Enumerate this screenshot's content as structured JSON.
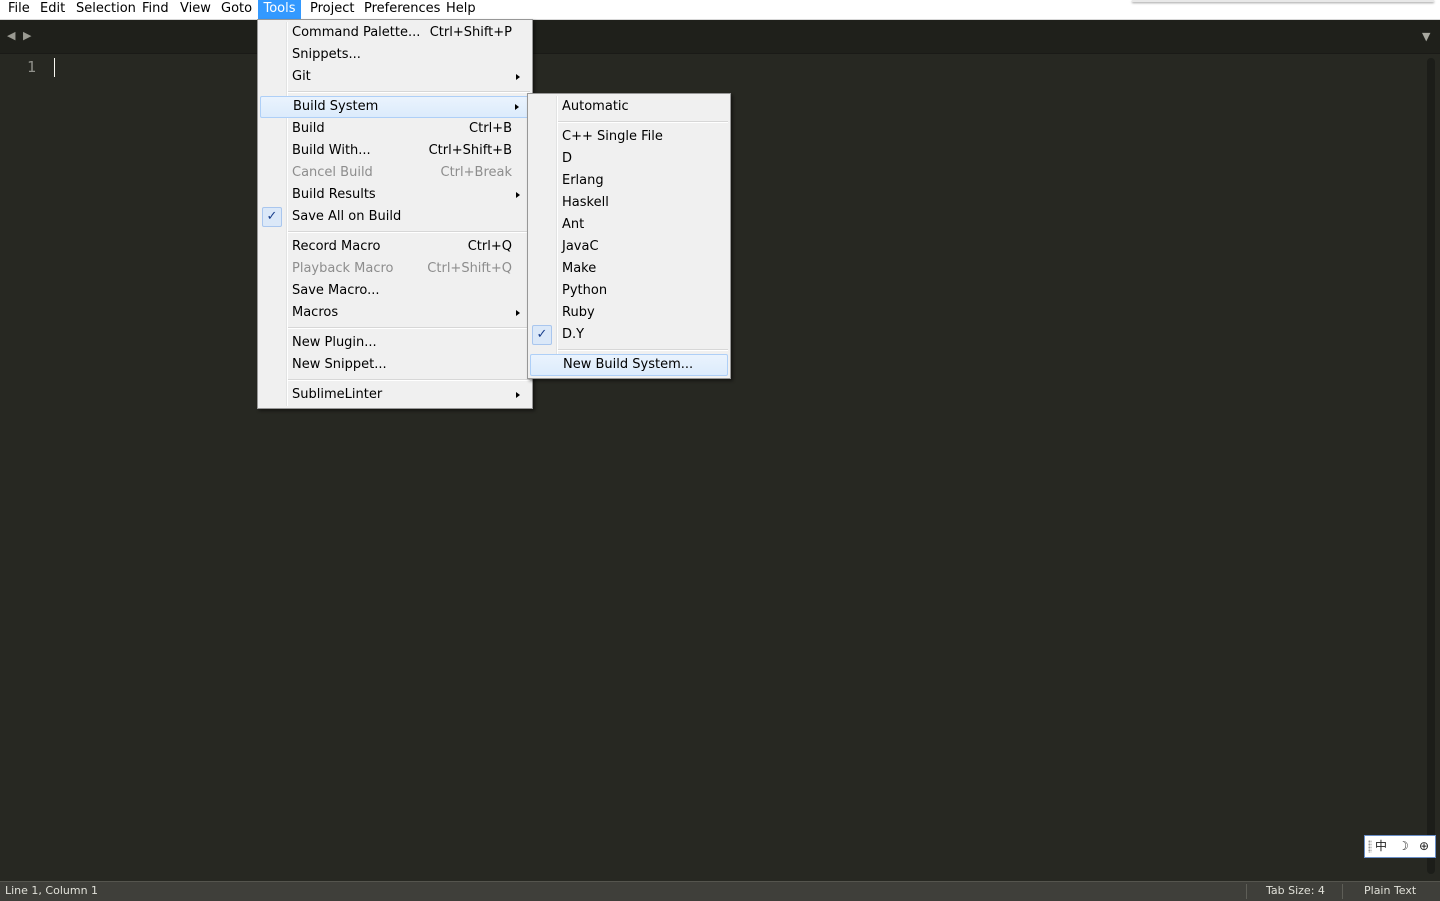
{
  "menubar": {
    "items": [
      "File",
      "Edit",
      "Selection",
      "Find",
      "View",
      "Goto",
      "Tools",
      "Project",
      "Preferences",
      "Help"
    ],
    "active": "Tools"
  },
  "editor": {
    "line_number": "1"
  },
  "tools_menu": {
    "command_palette": {
      "label": "Command Palette...",
      "shortcut": "Ctrl+Shift+P"
    },
    "snippets": {
      "label": "Snippets..."
    },
    "git": {
      "label": "Git"
    },
    "build_system": {
      "label": "Build System"
    },
    "build": {
      "label": "Build",
      "shortcut": "Ctrl+B"
    },
    "build_with": {
      "label": "Build With...",
      "shortcut": "Ctrl+Shift+B"
    },
    "cancel_build": {
      "label": "Cancel Build",
      "shortcut": "Ctrl+Break"
    },
    "build_results": {
      "label": "Build Results"
    },
    "save_all_on_build": {
      "label": "Save All on Build",
      "checked": true
    },
    "record_macro": {
      "label": "Record Macro",
      "shortcut": "Ctrl+Q"
    },
    "playback_macro": {
      "label": "Playback Macro",
      "shortcut": "Ctrl+Shift+Q"
    },
    "save_macro": {
      "label": "Save Macro..."
    },
    "macros": {
      "label": "Macros"
    },
    "new_plugin": {
      "label": "New Plugin..."
    },
    "new_snippet": {
      "label": "New Snippet..."
    },
    "sublimelinter": {
      "label": "SublimeLinter"
    }
  },
  "build_system_menu": {
    "automatic": "Automatic",
    "items": [
      "C++ Single File",
      "D",
      "Erlang",
      "Haskell",
      "Ant",
      "JavaC",
      "Make",
      "Python",
      "Ruby",
      "D.Y"
    ],
    "checked": "D.Y",
    "new_build_system": "New Build System..."
  },
  "statusbar": {
    "position": "Line 1, Column 1",
    "tab_size": "Tab Size: 4",
    "syntax": "Plain Text"
  },
  "ime": {
    "mode": "中",
    "punct": "☽",
    "extra": "⊕"
  }
}
